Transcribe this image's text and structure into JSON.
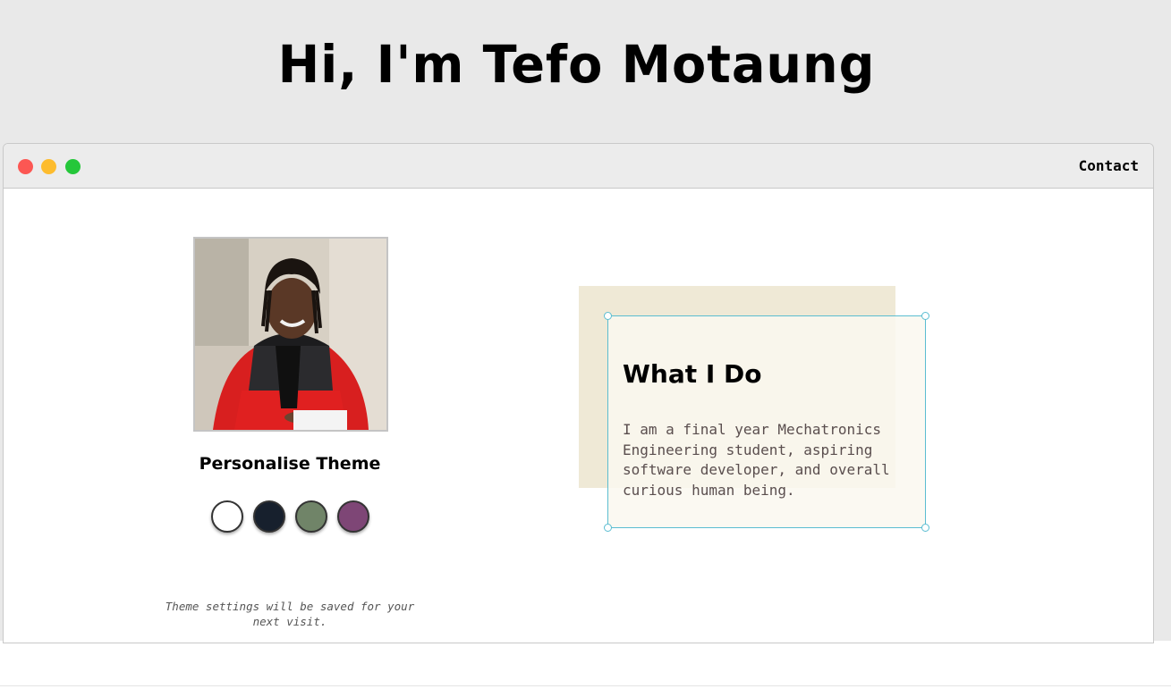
{
  "hero": {
    "title": "Hi, I'm Tefo Motaung"
  },
  "window": {
    "nav": {
      "contact_label": "Contact"
    }
  },
  "profile": {
    "theme_heading": "Personalise Theme",
    "theme_note": "Theme settings will be saved for your next visit.",
    "swatches": [
      {
        "name": "white",
        "color": "#ffffff"
      },
      {
        "name": "navy",
        "color": "#17202d"
      },
      {
        "name": "sage",
        "color": "#708468"
      },
      {
        "name": "plum",
        "color": "#7e4676"
      }
    ]
  },
  "about": {
    "title": "What I Do",
    "text": "I am a final year Mechatronics Engineering student, aspiring software developer, and overall curious human being."
  },
  "colors": {
    "background": "#e9e9e9",
    "card_border": "#5bbdd1",
    "card_back": "#efe9d6",
    "dot_red": "#fc5753",
    "dot_yellow": "#fdbc2e",
    "dot_green": "#25c73a"
  }
}
